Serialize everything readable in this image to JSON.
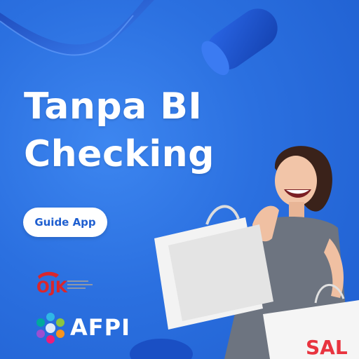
{
  "headline": {
    "line1": "Tanpa BI",
    "line2": "Checking"
  },
  "badge": {
    "label": "Guide App"
  },
  "logos": {
    "ojk": "OJK",
    "afpi": "AFPI"
  },
  "bag_text": "SAL",
  "colors": {
    "background": "#2b70e0",
    "accent": "#1f5fd0",
    "text": "#ffffff",
    "sale_red": "#e8343f"
  }
}
